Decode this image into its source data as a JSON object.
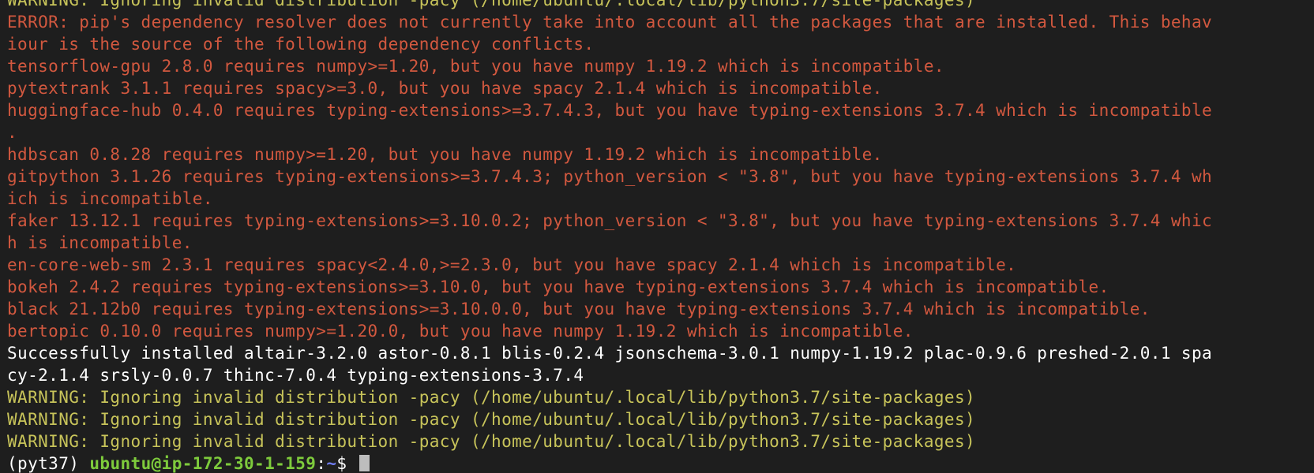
{
  "colors": {
    "background": "#1e1e1e",
    "warning": "#c8c45a",
    "error": "#d2583f",
    "success": "#ffffff",
    "prompt_user": "#7ecb3c",
    "prompt_dir": "#6f7cf0"
  },
  "lines": [
    "WARNING: Ignoring invalid distribution -pacy (/home/ubuntu/.local/lib/python3.7/site-packages)",
    "ERROR: pip's dependency resolver does not currently take into account all the packages that are installed. This behav",
    "iour is the source of the following dependency conflicts.",
    "tensorflow-gpu 2.8.0 requires numpy>=1.20, but you have numpy 1.19.2 which is incompatible.",
    "pytextrank 3.1.1 requires spacy>=3.0, but you have spacy 2.1.4 which is incompatible.",
    "huggingface-hub 0.4.0 requires typing-extensions>=3.7.4.3, but you have typing-extensions 3.7.4 which is incompatible",
    ".",
    "hdbscan 0.8.28 requires numpy>=1.20, but you have numpy 1.19.2 which is incompatible.",
    "gitpython 3.1.26 requires typing-extensions>=3.7.4.3; python_version < \"3.8\", but you have typing-extensions 3.7.4 wh",
    "ich is incompatible.",
    "faker 13.12.1 requires typing-extensions>=3.10.0.2; python_version < \"3.8\", but you have typing-extensions 3.7.4 whic",
    "h is incompatible.",
    "en-core-web-sm 2.3.1 requires spacy<2.4.0,>=2.3.0, but you have spacy 2.1.4 which is incompatible.",
    "bokeh 2.4.2 requires typing-extensions>=3.10.0, but you have typing-extensions 3.7.4 which is incompatible.",
    "black 21.12b0 requires typing-extensions>=3.10.0.0, but you have typing-extensions 3.7.4 which is incompatible.",
    "bertopic 0.10.0 requires numpy>=1.20.0, but you have numpy 1.19.2 which is incompatible.",
    "Successfully installed altair-3.2.0 astor-0.8.1 blis-0.2.4 jsonschema-3.0.1 numpy-1.19.2 plac-0.9.6 preshed-2.0.1 spa",
    "cy-2.1.4 srsly-0.0.7 thinc-7.0.4 typing-extensions-3.7.4",
    "WARNING: Ignoring invalid distribution -pacy (/home/ubuntu/.local/lib/python3.7/site-packages)",
    "WARNING: Ignoring invalid distribution -pacy (/home/ubuntu/.local/lib/python3.7/site-packages)",
    "WARNING: Ignoring invalid distribution -pacy (/home/ubuntu/.local/lib/python3.7/site-packages)"
  ],
  "prompt": {
    "env": "(pyt37) ",
    "user_host": "ubuntu@ip-172-30-1-159",
    "colon": ":",
    "dir": "~",
    "symbol": "$ "
  }
}
